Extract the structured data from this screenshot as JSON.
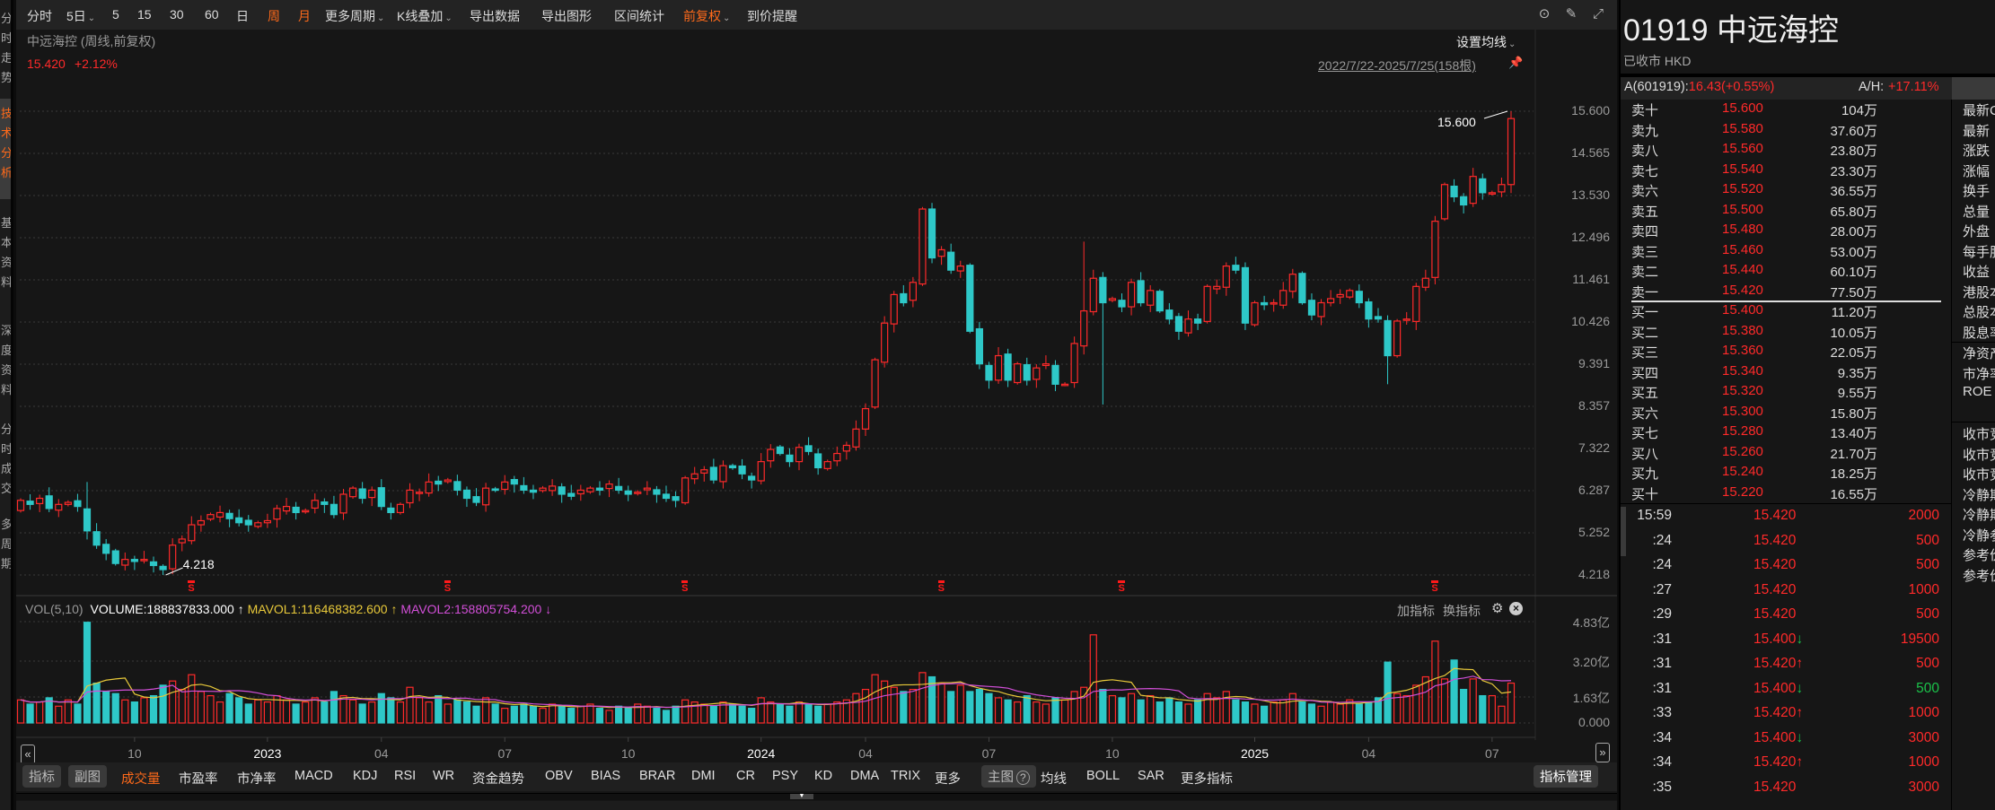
{
  "sidebar": {
    "tabs": [
      {
        "label": "分时走势",
        "active": false
      },
      {
        "label": "技术分析",
        "active": true
      },
      {
        "label": "基本资料",
        "active": false
      },
      {
        "label": "深度资料",
        "active": false
      },
      {
        "label": "分时成交",
        "active": false
      },
      {
        "label": "多周期",
        "active": false
      }
    ]
  },
  "toolbar": {
    "items": [
      {
        "label": "分时"
      },
      {
        "label": "5日",
        "dropdown": true
      },
      {
        "label": "5"
      },
      {
        "label": "15"
      },
      {
        "label": "30"
      },
      {
        "label": "60"
      },
      {
        "label": "日"
      },
      {
        "label": "周",
        "active": true
      },
      {
        "label": "月",
        "active": true
      },
      {
        "label": "更多周期",
        "dropdown": true
      },
      {
        "label": "K线叠加",
        "dropdown": true
      },
      {
        "label": "导出数据"
      },
      {
        "label": "导出图形"
      },
      {
        "label": "区间统计"
      },
      {
        "label": "前复权",
        "dropdown": true,
        "active": true
      },
      {
        "label": "到价提醒"
      }
    ],
    "icons": [
      "chevron-circle-down-icon",
      "brush-icon",
      "fullscreen-icon"
    ]
  },
  "chart_header": {
    "title": "中远海控 (周线,前复权)",
    "price": "15.420",
    "change": "+2.12%",
    "ma_settings": "设置均线",
    "date_range": "2022/7/22-2025/7/25(158根)"
  },
  "chart_data": {
    "type": "candlestick",
    "period": "weekly",
    "y_ticks": [
      "15.600",
      "14.565",
      "13.530",
      "12.496",
      "11.461",
      "10.426",
      "9.391",
      "8.357",
      "7.322",
      "6.287",
      "5.252",
      "4.218"
    ],
    "ylim": [
      4.218,
      15.6
    ],
    "closes": [
      6.05,
      5.95,
      6.1,
      5.85,
      5.95,
      6.0,
      5.9,
      5.3,
      4.95,
      4.75,
      4.5,
      4.6,
      4.55,
      4.6,
      4.45,
      4.35,
      4.95,
      5.1,
      5.45,
      5.55,
      5.7,
      5.75,
      5.6,
      5.5,
      5.45,
      5.5,
      5.55,
      5.85,
      5.9,
      5.75,
      5.8,
      6.05,
      5.95,
      5.7,
      6.2,
      6.35,
      6.1,
      6.3,
      5.9,
      5.75,
      5.95,
      6.3,
      6.25,
      6.5,
      6.45,
      6.55,
      6.3,
      6.1,
      6.0,
      6.35,
      6.3,
      6.5,
      6.45,
      6.3,
      6.25,
      6.35,
      6.4,
      6.2,
      6.15,
      6.3,
      6.35,
      6.3,
      6.45,
      6.3,
      6.2,
      6.25,
      6.35,
      6.2,
      6.1,
      6.05,
      6.6,
      6.7,
      6.8,
      6.55,
      6.9,
      6.85,
      6.7,
      6.55,
      7.0,
      7.3,
      7.2,
      7.0,
      7.35,
      7.25,
      6.85,
      7.0,
      7.2,
      7.4,
      7.8,
      8.3,
      9.5,
      10.4,
      11.1,
      10.9,
      11.4,
      13.2,
      12.0,
      12.2,
      11.7,
      11.8,
      10.2,
      9.4,
      9.0,
      9.6,
      9.0,
      9.4,
      9.0,
      9.3,
      9.4,
      8.9,
      8.9,
      9.9,
      10.7,
      11.5,
      10.9,
      11.0,
      10.8,
      11.4,
      10.9,
      11.2,
      10.7,
      10.5,
      10.2,
      10.5,
      10.4,
      11.3,
      11.3,
      11.8,
      11.7,
      10.4,
      10.9,
      10.85,
      10.9,
      11.2,
      11.6,
      10.9,
      10.6,
      10.9,
      11.0,
      11.1,
      11.2,
      10.9,
      10.5,
      10.5,
      9.6,
      10.45,
      10.5,
      11.3,
      11.5,
      12.9,
      13.8,
      13.5,
      13.3,
      14.0,
      13.6,
      13.6,
      13.8,
      15.42
    ],
    "first_open": 5.8,
    "last_open": 13.8,
    "wick_overrides": [
      {
        "index": 7,
        "high": 6.5
      },
      {
        "index": 15,
        "low": 4.218
      },
      {
        "index": 96,
        "high": 13.35
      },
      {
        "index": 112,
        "high": 12.4
      },
      {
        "index": 114,
        "low": 8.4
      },
      {
        "index": 144,
        "low": 8.9
      },
      {
        "index": 157,
        "high": 15.6
      }
    ],
    "high_label": {
      "index": 157,
      "text": "15.600"
    },
    "low_label": {
      "index": 15,
      "text": "4.218"
    },
    "signal_markers": {
      "indices": [
        18,
        45,
        70,
        97,
        116,
        149
      ],
      "text": "S"
    },
    "time_axis": [
      {
        "index": 12,
        "label": "10"
      },
      {
        "index": 26,
        "label": "2023",
        "year": true
      },
      {
        "index": 38,
        "label": "04"
      },
      {
        "index": 51,
        "label": "07"
      },
      {
        "index": 64,
        "label": "10"
      },
      {
        "index": 78,
        "label": "2024",
        "year": true
      },
      {
        "index": 89,
        "label": "04"
      },
      {
        "index": 102,
        "label": "07"
      },
      {
        "index": 115,
        "label": "10"
      },
      {
        "index": 130,
        "label": "2025",
        "year": true
      },
      {
        "index": 142,
        "label": "04"
      },
      {
        "index": 155,
        "label": "07"
      }
    ],
    "colors": {
      "up": "#ff2a2a",
      "down": "#2ec8c8",
      "mavol1": "#e8c93a",
      "mavol2": "#d24fd8"
    }
  },
  "volume": {
    "title": "VOL(5,10)",
    "volume_text": "VOLUME:188837833.000",
    "volume_arrow": "↑",
    "mavol1_text": "MAVOL1:116468382.600",
    "mavol1_arrow": "↑",
    "mavol2_text": "MAVOL2:158805754.200",
    "mavol2_arrow": "↓",
    "add_indicator": "加指标",
    "switch_indicator": "换指标",
    "y_ticks": [
      "4.83亿",
      "3.20亿",
      "1.63亿",
      "0.000"
    ],
    "ymax": 4.83,
    "unit": "亿",
    "values": [
      1.1,
      0.9,
      1.0,
      1.2,
      0.8,
      1.1,
      0.9,
      4.8,
      1.9,
      1.5,
      1.4,
      1.1,
      1.0,
      1.2,
      1.3,
      1.8,
      2.0,
      1.6,
      2.3,
      1.5,
      1.3,
      1.0,
      1.4,
      1.2,
      0.9,
      1.1,
      1.0,
      1.3,
      1.1,
      0.9,
      1.0,
      1.2,
      1.0,
      1.5,
      1.3,
      1.1,
      0.9,
      1.0,
      1.4,
      1.2,
      1.0,
      1.7,
      1.2,
      1.0,
      1.3,
      0.9,
      1.1,
      1.0,
      0.8,
      1.2,
      0.9,
      0.7,
      0.8,
      0.9,
      0.8,
      0.7,
      0.9,
      0.8,
      0.7,
      0.8,
      0.9,
      0.7,
      0.6,
      0.8,
      0.7,
      0.9,
      0.8,
      0.7,
      0.6,
      0.8,
      1.1,
      1.0,
      0.9,
      0.8,
      1.0,
      0.9,
      0.8,
      0.7,
      1.2,
      1.0,
      0.9,
      0.8,
      1.0,
      0.9,
      0.8,
      0.9,
      1.0,
      1.1,
      1.4,
      1.6,
      2.3,
      2.0,
      1.7,
      1.5,
      1.6,
      2.4,
      2.2,
      1.9,
      1.5,
      1.8,
      1.5,
      1.6,
      1.4,
      1.2,
      1.1,
      1.0,
      1.3,
      1.0,
      0.9,
      1.2,
      1.1,
      1.5,
      1.7,
      4.2,
      1.6,
      1.3,
      1.2,
      1.4,
      1.1,
      1.3,
      1.0,
      1.2,
      1.0,
      0.9,
      1.1,
      1.4,
      1.2,
      1.5,
      1.1,
      1.0,
      0.9,
      0.8,
      1.0,
      1.1,
      1.4,
      1.0,
      0.9,
      0.8,
      1.0,
      0.9,
      1.1,
      0.9,
      1.0,
      1.2,
      2.9,
      1.4,
      1.3,
      1.8,
      2.2,
      3.9,
      2.1,
      3.0,
      1.6,
      2.1,
      1.3,
      1.3,
      0.8,
      1.9
    ]
  },
  "indicator_bar": {
    "left_buttons": [
      "指标",
      "副图"
    ],
    "items": [
      "成交量",
      "市盈率",
      "市净率",
      "MACD",
      "KDJ",
      "RSI",
      "WR",
      "资金趋势",
      "OBV",
      "BIAS",
      "BRAR",
      "DMI",
      "CR",
      "PSY",
      "KD",
      "DMA",
      "TRIX",
      "更多"
    ],
    "active": "成交量",
    "main_button": "主图",
    "main_items": [
      "均线",
      "BOLL",
      "SAR",
      "更多指标"
    ],
    "manage_button": "指标管理"
  },
  "quote": {
    "title": "01919 中远海控",
    "status": "已收市 HKD",
    "a_share_label": "A(601919):",
    "a_share_value": "16.43(+0.55%)",
    "ah_label": "A/H:",
    "ah_value": "+17.11%"
  },
  "order_book": {
    "asks": [
      {
        "label": "卖十",
        "price": "15.600",
        "vol": "104万"
      },
      {
        "label": "卖九",
        "price": "15.580",
        "vol": "37.60万"
      },
      {
        "label": "卖八",
        "price": "15.560",
        "vol": "23.80万"
      },
      {
        "label": "卖七",
        "price": "15.540",
        "vol": "23.30万"
      },
      {
        "label": "卖六",
        "price": "15.520",
        "vol": "36.55万"
      },
      {
        "label": "卖五",
        "price": "15.500",
        "vol": "65.80万"
      },
      {
        "label": "卖四",
        "price": "15.480",
        "vol": "28.00万"
      },
      {
        "label": "卖三",
        "price": "15.460",
        "vol": "53.00万"
      },
      {
        "label": "卖二",
        "price": "15.440",
        "vol": "60.10万"
      },
      {
        "label": "卖一",
        "price": "15.420",
        "vol": "77.50万"
      }
    ],
    "bids": [
      {
        "label": "买一",
        "price": "15.400",
        "vol": "11.20万"
      },
      {
        "label": "买二",
        "price": "15.380",
        "vol": "10.05万"
      },
      {
        "label": "买三",
        "price": "15.360",
        "vol": "22.05万"
      },
      {
        "label": "买四",
        "price": "15.340",
        "vol": "9.35万"
      },
      {
        "label": "买五",
        "price": "15.320",
        "vol": "9.55万"
      },
      {
        "label": "买六",
        "price": "15.300",
        "vol": "15.80万"
      },
      {
        "label": "买七",
        "price": "15.280",
        "vol": "13.40万"
      },
      {
        "label": "买八",
        "price": "15.260",
        "vol": "21.70万"
      },
      {
        "label": "买九",
        "price": "15.240",
        "vol": "18.25万"
      },
      {
        "label": "买十",
        "price": "15.220",
        "vol": "16.55万"
      }
    ]
  },
  "info_labels": {
    "group1": [
      "最新C",
      "最新",
      "涨跌",
      "涨幅",
      "换手",
      "总量",
      "外盘",
      "每手股",
      "收益",
      "港股本",
      "总股本",
      "股息率"
    ],
    "group2": [
      "净资产",
      "市净率",
      "ROE"
    ],
    "group3": [
      "收市竞",
      "收市竞",
      "收市竞",
      "冷静期",
      "冷静期",
      "冷静参",
      "参考价",
      "参考价"
    ]
  },
  "trades": [
    {
      "time": "15:59",
      "price": "15.420",
      "arrow": "",
      "vol": "2000",
      "side": "buy"
    },
    {
      "time": ":24",
      "price": "15.420",
      "arrow": "",
      "vol": "500",
      "side": "buy"
    },
    {
      "time": ":24",
      "price": "15.420",
      "arrow": "",
      "vol": "500",
      "side": "buy"
    },
    {
      "time": ":27",
      "price": "15.420",
      "arrow": "",
      "vol": "1000",
      "side": "buy"
    },
    {
      "time": ":29",
      "price": "15.420",
      "arrow": "",
      "vol": "500",
      "side": "buy"
    },
    {
      "time": ":31",
      "price": "15.400",
      "arrow": "down",
      "vol": "19500",
      "side": "buy"
    },
    {
      "time": ":31",
      "price": "15.420",
      "arrow": "up",
      "vol": "500",
      "side": "buy"
    },
    {
      "time": ":31",
      "price": "15.400",
      "arrow": "down",
      "vol": "500",
      "side": "sell"
    },
    {
      "time": ":33",
      "price": "15.420",
      "arrow": "up",
      "vol": "1000",
      "side": "buy"
    },
    {
      "time": ":34",
      "price": "15.400",
      "arrow": "down",
      "vol": "3000",
      "side": "buy"
    },
    {
      "time": ":34",
      "price": "15.420",
      "arrow": "up",
      "vol": "1000",
      "side": "buy"
    },
    {
      "time": ":35",
      "price": "15.420",
      "arrow": "",
      "vol": "3000",
      "side": "buy"
    }
  ]
}
